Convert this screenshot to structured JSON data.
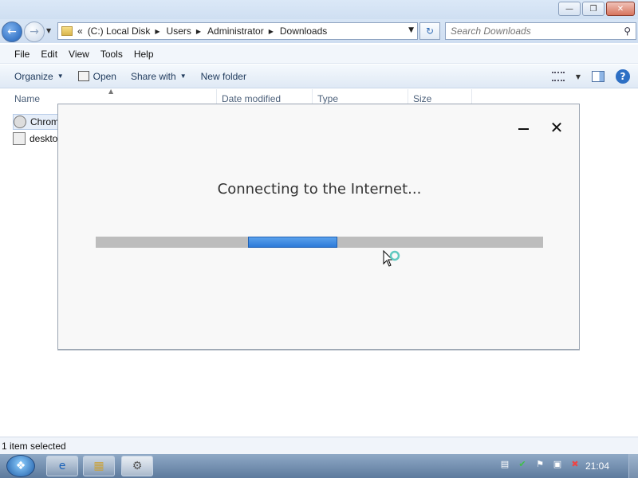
{
  "explorer": {
    "breadcrumb": {
      "overflow": "«",
      "items": [
        "(C:) Local Disk",
        "Users",
        "Administrator",
        "Downloads"
      ]
    },
    "search_placeholder": "Search Downloads",
    "menu": [
      "File",
      "Edit",
      "View",
      "Tools",
      "Help"
    ],
    "toolbar": {
      "organize": "Organize",
      "open": "Open",
      "share_with": "Share with",
      "new_folder": "New folder"
    },
    "columns": [
      "Name",
      "Date modified",
      "Type",
      "Size"
    ],
    "files": [
      {
        "name": "Chrom",
        "icon": "chrome-installer-icon",
        "selected": true
      },
      {
        "name": "deskto",
        "icon": "settings-file-icon",
        "selected": false
      }
    ],
    "status": "1 item selected"
  },
  "dialog": {
    "message": "Connecting to the Internet...",
    "progress": {
      "start_fraction": 0.34,
      "length_fraction": 0.2
    }
  },
  "taskbar": {
    "buttons": [
      "internet-explorer-icon",
      "windows-explorer-icon",
      "chrome-installer-icon"
    ],
    "tray_icons": [
      "action-center-icon",
      "security-icon",
      "flag-icon",
      "network-icon",
      "volume-muted-icon"
    ],
    "clock": "21:04"
  },
  "colors": {
    "accent": "#2d7ad8",
    "track": "#bdbdbd"
  }
}
